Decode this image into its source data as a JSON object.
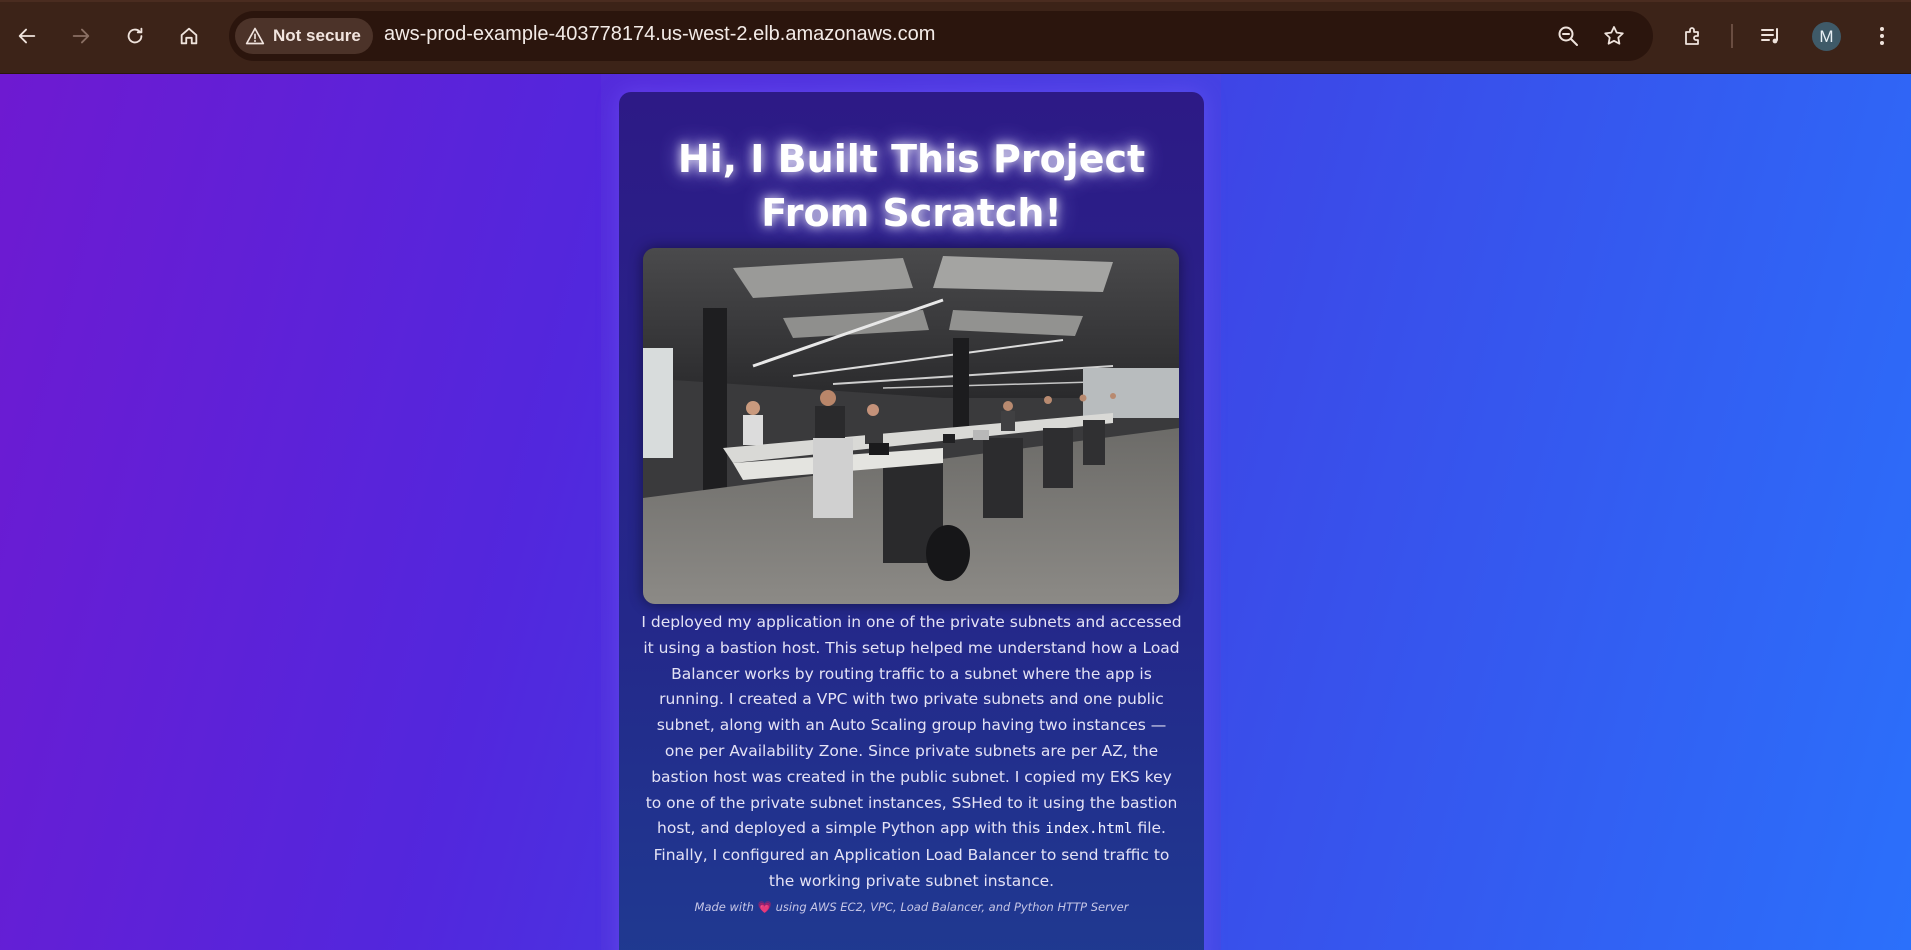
{
  "browser": {
    "security_label": "Not secure",
    "url": "aws-prod-example-403778174.us-west-2.elb.amazonaws.com",
    "profile_initial": "M"
  },
  "page": {
    "title": "Hi, I Built This Project From Scratch!",
    "description_part1": "I deployed my application in one of the private subnets and accessed it using a bastion host. This setup helped me understand how a Load Balancer works by routing traffic to a subnet where the app is running. I created a VPC with two private subnets and one public subnet, along with an Auto Scaling group having two instances — one per Availability Zone. Since private subnets are per AZ, the bastion host was created in the public subnet. I copied my EKS key to one of the private subnet instances, SSHed to it using the bastion host, and deployed a simple Python app with this ",
    "description_code": "index.html",
    "description_part2": " file. Finally, I configured an Application Load Balancer to send traffic to the working private subnet instance.",
    "footer_prefix": "Made with ",
    "footer_heart": "💗",
    "footer_suffix": " using AWS EC2, VPC, Load Balancer, and Python HTTP Server"
  }
}
